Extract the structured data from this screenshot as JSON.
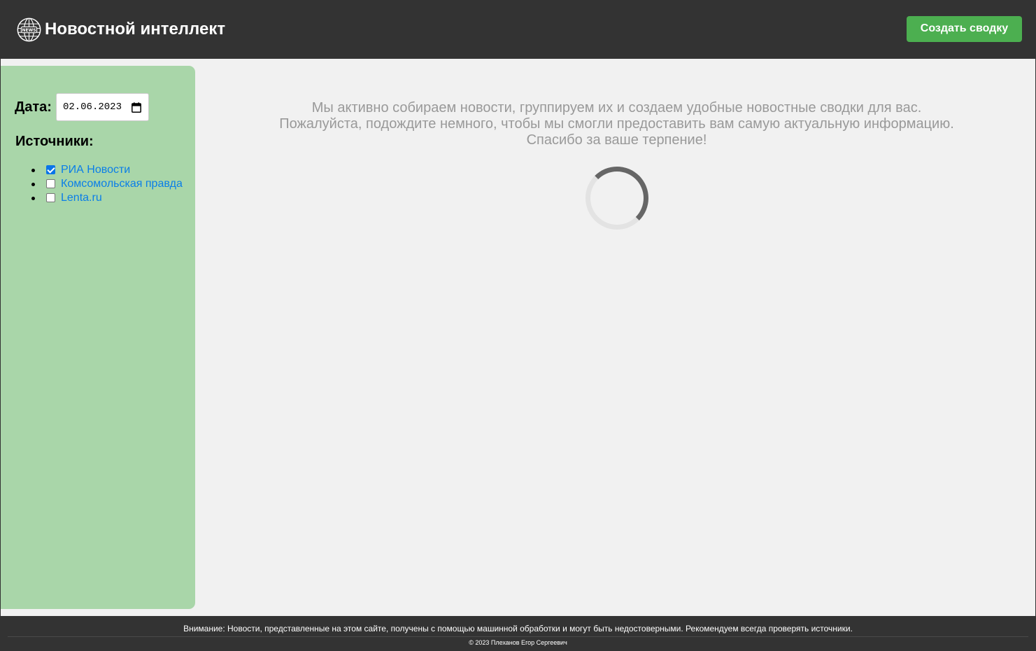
{
  "header": {
    "title": "Новостной интеллект",
    "logo_text": "NEWS",
    "create_button": "Создать сводку"
  },
  "sidebar": {
    "date_label": "Дата:",
    "date_value": "02.06.2023",
    "sources_title": "Источники:",
    "sources": [
      {
        "label": "РИА Новости",
        "checked": true
      },
      {
        "label": "Комсомольская правда",
        "checked": false
      },
      {
        "label": "Lenta.ru",
        "checked": false
      }
    ]
  },
  "main": {
    "message_line1": "Мы активно собираем новости, группируем их и создаем удобные новостные сводки для вас.",
    "message_line2": "Пожалуйста, подождите немного, чтобы мы смогли предоставить вам самую актуальную информацию.",
    "message_line3": "Спасибо за ваше терпение!"
  },
  "footer": {
    "disclaimer": "Внимание: Новости, представленные на этом сайте, получены с помощью машинной обработки и могут быть недостоверными. Рекомендуем всегда проверять источники.",
    "copyright": "© 2023 Плеханов Егор Сергеевич"
  },
  "colors": {
    "header_bg": "#333333",
    "accent_green": "#4caf50",
    "sidebar_bg": "#a9d6a9",
    "link_blue": "#0a7ee8",
    "muted_text": "#999999"
  },
  "icons": [
    "globe-news-logo-icon",
    "calendar-icon",
    "loading-spinner-icon"
  ]
}
